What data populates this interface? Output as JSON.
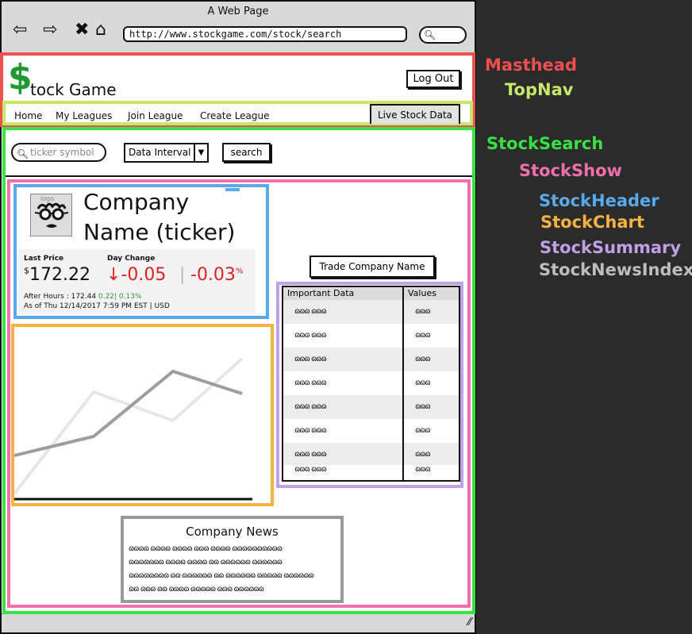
{
  "browser": {
    "window_title": "A Web Page",
    "url": "http://www.stockgame.com/stock/search"
  },
  "masthead": {
    "brand_dollar": "$",
    "brand_text": "tock Game",
    "logout_label": "Log Out"
  },
  "topnav": {
    "items": [
      "Home",
      "My Leagues",
      "Join League",
      "Create League"
    ],
    "live_data_label": "Live Stock Data"
  },
  "stock_search": {
    "ticker_placeholder": "ticker symbol",
    "interval_label": "Data Interval",
    "search_label": "search"
  },
  "stock_header": {
    "logo_label": "logo",
    "company_line1": "Company",
    "company_line2": "Name (ticker)",
    "last_price_label": "Last Price",
    "currency_symbol": "$",
    "last_price": "172.22",
    "day_change_label": "Day Change",
    "day_change_arrow": "↓",
    "day_change": "-0.05",
    "separator": "|",
    "day_change_pct": "-0.03",
    "pct_symbol": "%",
    "after_hours_label": "After Hours :",
    "after_hours_price": "172.44",
    "after_hours_change": "0.22| 0.13%",
    "as_of": "As of  Thu 12/14/2017 7:59 PM   EST | USD"
  },
  "trade_button_label": "Trade Company Name",
  "summary": {
    "col_data": "Important Data",
    "col_values": "Values",
    "rows": [
      {
        "data": "ɷɷɷ ɷɷɷ",
        "value": "ɷɷɷ"
      },
      {
        "data": "ɷɷɷ ɷɷɷ",
        "value": "ɷɷɷ"
      },
      {
        "data": "ɷɷɷ ɷɷɷ",
        "value": "ɷɷɷ"
      },
      {
        "data": "ɷɷɷ ɷɷɷ",
        "value": "ɷɷɷ"
      },
      {
        "data": "ɷɷɷ ɷɷɷ",
        "value": "ɷɷɷ"
      },
      {
        "data": "ɷɷɷ ɷɷɷ",
        "value": "ɷɷɷ"
      },
      {
        "data": "ɷɷɷ ɷɷɷ",
        "value": "ɷɷɷ"
      },
      {
        "data": "ɷɷɷ ɷɷɷ",
        "value": "ɷɷɷ"
      }
    ]
  },
  "news": {
    "title": "Company News",
    "lines": [
      "ɷɷɷɷ ɷɷɷɷ ɷɷɷɷ ɷɷɷ ɷɷɷɷ ɷɷɷɷɷɷɷɷɷɷ",
      "ɷɷɷɷɷɷɷ ɷɷɷɷ ɷɷɷɷ ɷɷ ɷɷɷɷɷɷ ɷɷɷɷɷɷ",
      "ɷɷɷɷɷɷɷɷ ɷɷ ɷɷɷɷɷɷ ɷɷ ɷɷɷɷɷɷ ɷɷɷɷɷ ɷɷɷɷɷɷ",
      "ɷɷ ɷɷɷ ɷɷ ɷɷɷɷ ɷɷɷɷɷ ɷɷɷ ɷɷɷɷɷɷ"
    ]
  },
  "annotations": {
    "masthead": "Masthead",
    "topnav": "TopNav",
    "stock_search": "StockSearch",
    "stock_show": "StockShow",
    "stock_header": "StockHeader",
    "stock_chart": "StockChart",
    "stock_summary": "StockSummary",
    "stock_news_index": "StockNewsIndex"
  },
  "colors": {
    "masthead": "#ef4f4f",
    "topnav": "#c6e86a",
    "stock_search": "#39e046",
    "stock_show": "#f06fac",
    "stock_header": "#5aa9ea",
    "stock_chart": "#f7b243",
    "stock_summary": "#c2a0e8",
    "stock_news_index": "#999999",
    "brand_green": "#1e9a2e",
    "negative_red": "#e02020"
  }
}
